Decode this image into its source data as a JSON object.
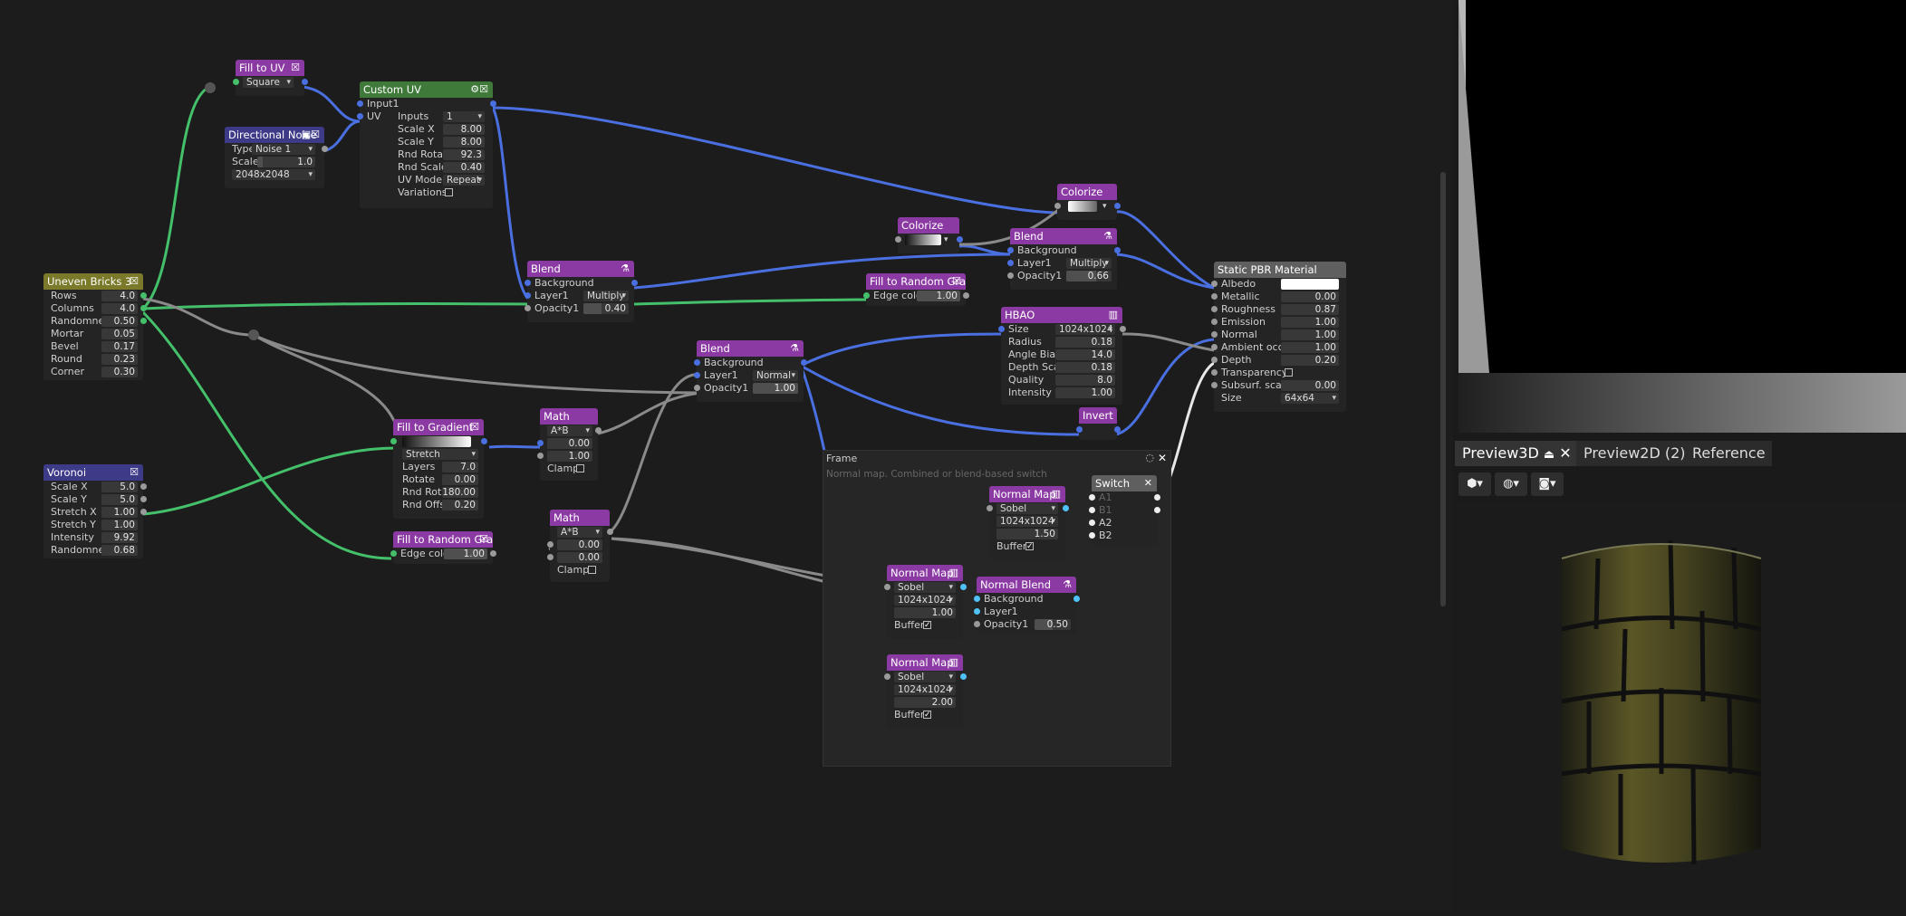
{
  "nodes": {
    "fill_to_uv": {
      "title": "Fill to UV",
      "mode": "Square"
    },
    "directional_noise": {
      "title": "Directional Noise",
      "type_label": "Type",
      "type_value": "Noise 1",
      "scale_label": "Scale",
      "scale_value": "1.0",
      "size": "2048x2048"
    },
    "custom_uv": {
      "title": "Custom UV",
      "input1": "Input1",
      "uv": "UV",
      "inputs_label": "Inputs",
      "inputs_value": "1",
      "params": [
        {
          "label": "Scale X",
          "value": "8.00"
        },
        {
          "label": "Scale Y",
          "value": "8.00"
        },
        {
          "label": "Rnd Rotate",
          "value": "92.3"
        },
        {
          "label": "Rnd Scale",
          "value": "0.40"
        }
      ],
      "uvmode_label": "UV Mode",
      "uvmode_value": "Repeat",
      "variations_label": "Variations"
    },
    "uneven_bricks": {
      "title": "Uneven Bricks 3",
      "params": [
        {
          "label": "Rows",
          "value": "4.0"
        },
        {
          "label": "Columns",
          "value": "4.0"
        },
        {
          "label": "Randomness",
          "value": "0.50"
        },
        {
          "label": "Mortar",
          "value": "0.05"
        },
        {
          "label": "Bevel",
          "value": "0.17"
        },
        {
          "label": "Round",
          "value": "0.23"
        },
        {
          "label": "Corner",
          "value": "0.30"
        }
      ]
    },
    "voronoi": {
      "title": "Voronoi",
      "params": [
        {
          "label": "Scale X",
          "value": "5.0"
        },
        {
          "label": "Scale Y",
          "value": "5.0"
        },
        {
          "label": "Stretch X",
          "value": "1.00"
        },
        {
          "label": "Stretch Y",
          "value": "1.00"
        },
        {
          "label": "Intensity",
          "value": "9.92"
        },
        {
          "label": "Randomness",
          "value": "0.68"
        }
      ]
    },
    "blend1": {
      "title": "Blend",
      "background": "Background",
      "layer1": "Layer1",
      "mode": "Multiply",
      "opacity_label": "Opacity1",
      "opacity": "0.40"
    },
    "fill_to_gradient": {
      "title": "Fill to Gradient",
      "mode": "Stretch",
      "params": [
        {
          "label": "Layers",
          "value": "7.0"
        },
        {
          "label": "Rotate",
          "value": "0.00"
        },
        {
          "label": "Rnd Rotate",
          "value": "180.00"
        },
        {
          "label": "Rnd Offset",
          "value": "0.20"
        }
      ]
    },
    "fill_random_gray1": {
      "title": "Fill to Random Gray",
      "edge_label": "Edge color",
      "edge_value": "1.00"
    },
    "math1": {
      "title": "Math",
      "op": "A*B",
      "a": "0.00",
      "b": "1.00",
      "clamp": "Clamp"
    },
    "math2": {
      "title": "Math",
      "op": "A*B",
      "a": "0.00",
      "b": "0.00",
      "clamp": "Clamp"
    },
    "blend2": {
      "title": "Blend",
      "background": "Background",
      "layer1": "Layer1",
      "mode": "Normal",
      "opacity_label": "Opacity1",
      "opacity": "1.00"
    },
    "colorize1": {
      "title": "Colorize"
    },
    "colorize2": {
      "title": "Colorize"
    },
    "fill_random_gray2": {
      "title": "Fill to Random Gray",
      "edge_label": "Edge color",
      "edge_value": "1.00"
    },
    "blend3": {
      "title": "Blend",
      "background": "Background",
      "layer1": "Layer1",
      "mode": "Multiply",
      "opacity_label": "Opacity1",
      "opacity": "0.66"
    },
    "hbao": {
      "title": "HBAO",
      "size_label": "Size",
      "size_value": "1024x1024",
      "params": [
        {
          "label": "Radius",
          "value": "0.18"
        },
        {
          "label": "Angle Bias",
          "value": "14.0"
        },
        {
          "label": "Depth Scale",
          "value": "0.18"
        },
        {
          "label": "Quality",
          "value": "8.0"
        },
        {
          "label": "Intensity",
          "value": "1.00"
        }
      ]
    },
    "invert": {
      "title": "Invert"
    },
    "pbr": {
      "title": "Static PBR Material",
      "rows": [
        {
          "label": "Albedo",
          "value": ""
        },
        {
          "label": "Metallic",
          "value": "0.00"
        },
        {
          "label": "Roughness",
          "value": "0.87"
        },
        {
          "label": "Emission",
          "value": "1.00"
        },
        {
          "label": "Normal",
          "value": "1.00"
        },
        {
          "label": "Ambient occl...",
          "value": "1.00"
        },
        {
          "label": "Depth",
          "value": "0.20"
        }
      ],
      "transparency": "Transparency",
      "subsurf_label": "Subsurf. scat...",
      "subsurf_value": "0.00",
      "size_label": "Size",
      "size_value": "64x64"
    },
    "frame": {
      "title": "Frame",
      "comment": "Normal map. Combined or blend-based switch"
    },
    "normal_map1": {
      "title": "Normal Map",
      "method": "Sobel",
      "size": "1024x1024",
      "value": "1.50",
      "buffer": "Buffer"
    },
    "normal_map2": {
      "title": "Normal Map",
      "method": "Sobel",
      "size": "1024x1024",
      "value": "1.00",
      "buffer": "Buffer"
    },
    "normal_map3": {
      "title": "Normal Map",
      "method": "Sobel",
      "size": "1024x1024",
      "value": "2.00",
      "buffer": "Buffer"
    },
    "normal_blend": {
      "title": "Normal Blend",
      "background": "Background",
      "layer1": "Layer1",
      "opacity_label": "Opacity1",
      "opacity": "0.50"
    },
    "switch": {
      "title": "Switch",
      "a1": "A1",
      "b1": "B1",
      "a2": "A2",
      "b2": "B2"
    }
  },
  "tabs": [
    {
      "label": "Preview3D",
      "active": true
    },
    {
      "label": "Preview2D (2)",
      "active": false
    },
    {
      "label": "Reference",
      "active": false
    }
  ],
  "toolbar3d": [
    {
      "icon": "model-icon"
    },
    {
      "icon": "environment-globe-icon"
    },
    {
      "icon": "camera-icon"
    }
  ],
  "colors": {
    "purple": "#8c3aa3",
    "green": "#3f7a3b",
    "blue": "#3d3a88",
    "olive": "#7a7a2a",
    "gray": "#5f5f5f",
    "wire_blue": "#4a6fe0",
    "wire_green": "#44c06a",
    "wire_gray": "#9a9a9a",
    "wire_cyan": "#4fc3f7"
  }
}
